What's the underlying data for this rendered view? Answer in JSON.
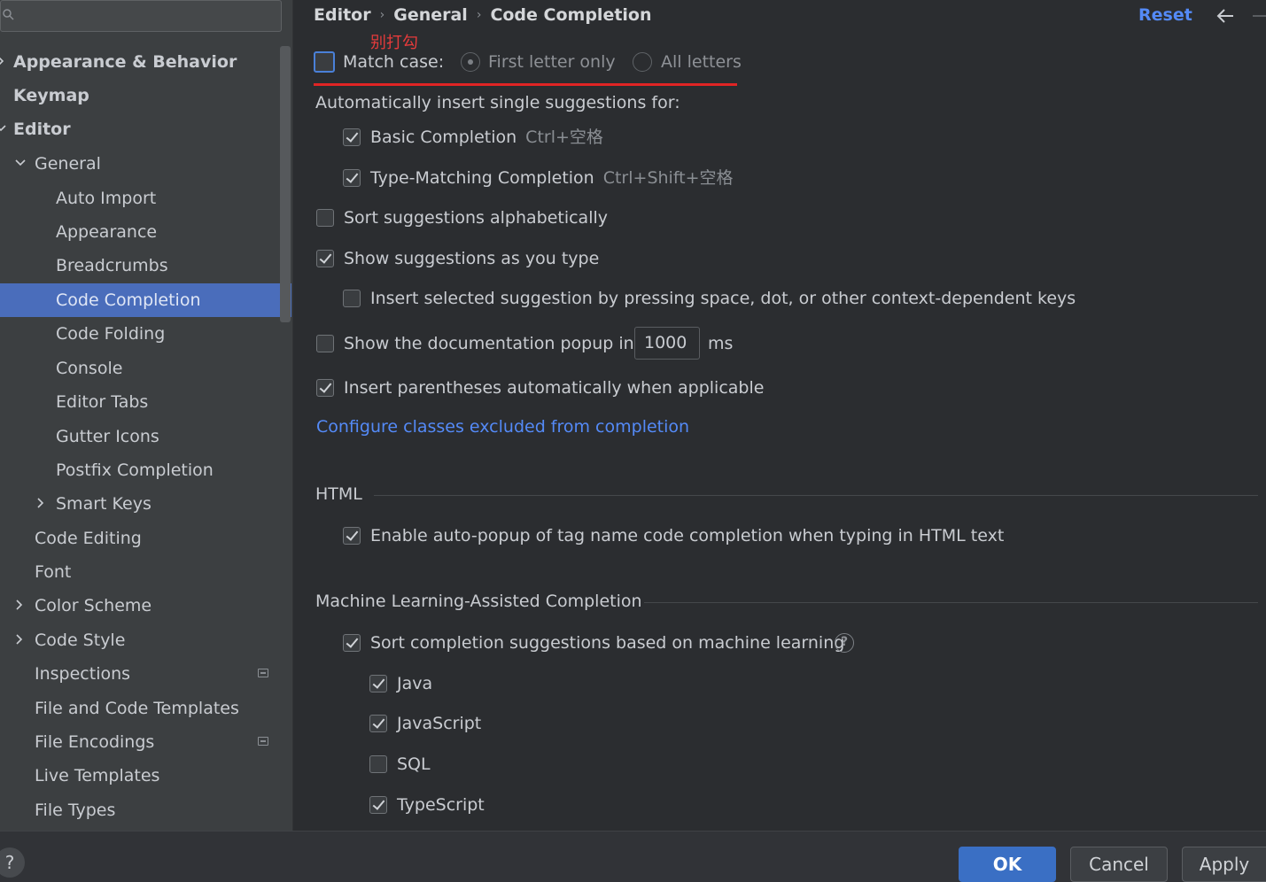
{
  "sidebar": {
    "search_placeholder": "",
    "items": [
      {
        "label": "Appearance & Behavior"
      },
      {
        "label": "Keymap"
      },
      {
        "label": "Editor"
      },
      {
        "label": "General"
      },
      {
        "label": "Auto Import"
      },
      {
        "label": "Appearance"
      },
      {
        "label": "Breadcrumbs"
      },
      {
        "label": "Code Completion"
      },
      {
        "label": "Code Folding"
      },
      {
        "label": "Console"
      },
      {
        "label": "Editor Tabs"
      },
      {
        "label": "Gutter Icons"
      },
      {
        "label": "Postfix Completion"
      },
      {
        "label": "Smart Keys"
      },
      {
        "label": "Code Editing"
      },
      {
        "label": "Font"
      },
      {
        "label": "Color Scheme"
      },
      {
        "label": "Code Style"
      },
      {
        "label": "Inspections"
      },
      {
        "label": "File and Code Templates"
      },
      {
        "label": "File Encodings"
      },
      {
        "label": "Live Templates"
      },
      {
        "label": "File Types"
      }
    ]
  },
  "header": {
    "crumbs": [
      "Editor",
      "General",
      "Code Completion"
    ],
    "reset_label": "Reset"
  },
  "annotation": "别打勾",
  "match_case": {
    "label": "Match case:",
    "checked": false,
    "options": [
      "First letter only",
      "All letters"
    ],
    "selected": "First letter only"
  },
  "auto_insert": {
    "heading": "Automatically insert single suggestions for:",
    "basic": {
      "label": "Basic Completion",
      "shortcut": "Ctrl+空格",
      "checked": true
    },
    "type_matching": {
      "label": "Type-Matching Completion",
      "shortcut": "Ctrl+Shift+空格",
      "checked": true
    }
  },
  "options": {
    "sort_alpha": {
      "label": "Sort suggestions alphabetically",
      "checked": false
    },
    "show_as_type": {
      "label": "Show suggestions as you type",
      "checked": true
    },
    "insert_selected": {
      "label": "Insert selected suggestion by pressing space, dot, or other context-dependent keys",
      "checked": false
    },
    "doc_popup": {
      "label": "Show the documentation popup in",
      "value": "1000",
      "unit": "ms",
      "checked": false
    },
    "parentheses": {
      "label": "Insert parentheses automatically when applicable",
      "checked": true
    },
    "configure_link": "Configure classes excluded from completion"
  },
  "html_section": {
    "title": "HTML",
    "auto_popup": {
      "label": "Enable auto-popup of tag name code completion when typing in HTML text",
      "checked": true
    }
  },
  "ml_section": {
    "title": "Machine Learning-Assisted Completion",
    "sort_ml": {
      "label": "Sort completion suggestions based on machine learning",
      "checked": true
    },
    "languages": [
      {
        "label": "Java",
        "checked": true
      },
      {
        "label": "JavaScript",
        "checked": true
      },
      {
        "label": "SQL",
        "checked": false
      },
      {
        "label": "TypeScript",
        "checked": true
      }
    ]
  },
  "footer": {
    "help": "?",
    "ok": "OK",
    "cancel": "Cancel",
    "apply": "Apply"
  },
  "colors": {
    "accent": "#548af7",
    "selection": "#4a6dbb",
    "annotation_red": "#e02424"
  }
}
